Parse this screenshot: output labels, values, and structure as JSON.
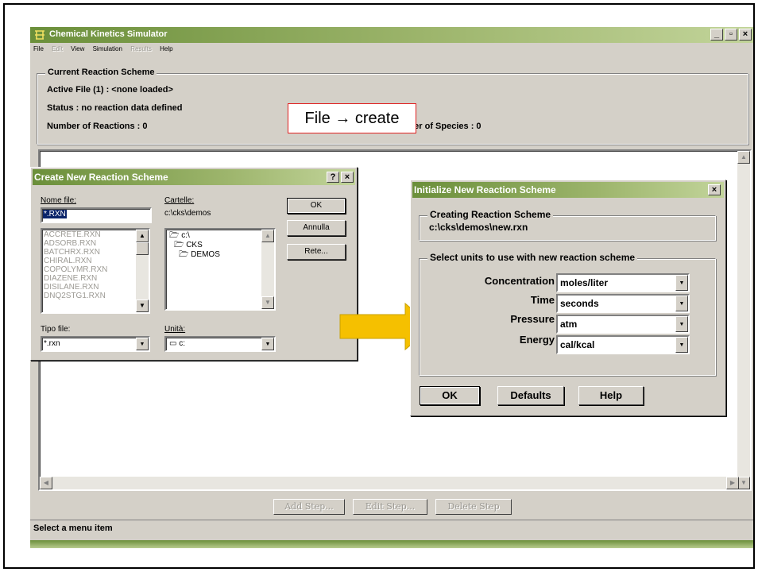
{
  "app": {
    "title": "Chemical Kinetics Simulator",
    "window_controls": [
      "_",
      "▫",
      "×"
    ]
  },
  "menu": [
    {
      "label": "File",
      "enabled": true
    },
    {
      "label": "Edit",
      "enabled": false
    },
    {
      "label": "View",
      "enabled": true
    },
    {
      "label": "Simulation",
      "enabled": true
    },
    {
      "label": "Results",
      "enabled": false
    },
    {
      "label": "Help",
      "enabled": true
    }
  ],
  "current_scheme": {
    "legend": "Current Reaction Scheme",
    "active_file": "Active File (1) : <none loaded>",
    "status": "Status : no reaction data defined",
    "num_reactions": "Number of Reactions : 0",
    "num_species": "Number of Species : 0"
  },
  "annotation": "File → create",
  "step_buttons": {
    "add": "Add Step...",
    "edit": "Edit Step...",
    "delete": "Delete Step"
  },
  "statusbar": "Select a menu item",
  "create_dialog": {
    "title": "Create New Reaction Scheme",
    "help_btn": "?",
    "close_btn": "×",
    "filename_label": "Nome file:",
    "filename_value": "*.RXN",
    "folders_label": "Cartelle:",
    "folder_path": "c:\\cks\\demos",
    "files": [
      "ACCRETE.RXN",
      "ADSORB.RXN",
      "BATCHRX.RXN",
      "CHIRAL.RXN",
      "COPOLYMR.RXN",
      "DIAZENE.RXN",
      "DISILANE.RXN",
      "DNQ2STG1.RXN"
    ],
    "folder_tree": [
      "c:\\",
      "CKS",
      "DEMOS"
    ],
    "filetype_label": "Tipo file:",
    "filetype_value": "*.rxn",
    "drive_label": "Unità:",
    "drive_value": "c:",
    "ok": "OK",
    "cancel": "Annulla",
    "network": "Rete..."
  },
  "init_dialog": {
    "title": "Initialize New Reaction Scheme",
    "close_btn": "×",
    "creating_legend": "Creating Reaction Scheme",
    "creating_path": "c:\\cks\\demos\\new.rxn",
    "units_legend": "Select units to use with new reaction scheme",
    "units": [
      {
        "label": "Concentration",
        "value": "moles/liter"
      },
      {
        "label": "Time",
        "value": "seconds"
      },
      {
        "label": "Pressure",
        "value": "atm"
      },
      {
        "label": "Energy",
        "value": "cal/kcal"
      }
    ],
    "ok": "OK",
    "defaults": "Defaults",
    "help": "Help"
  },
  "colors": {
    "titlebar_start": "#6b8f3a",
    "titlebar_end": "#c2d49a",
    "window_bg": "#d4d0c8",
    "annotation_border": "#e02020",
    "arrow_fill": "#f5c000"
  }
}
